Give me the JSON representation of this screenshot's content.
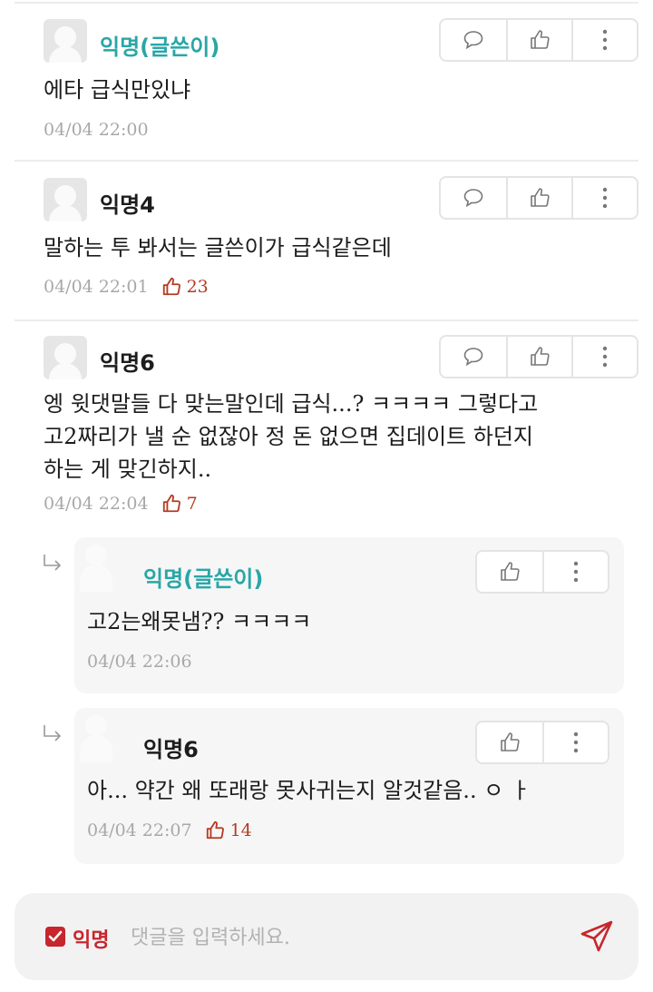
{
  "comments": [
    {
      "author": "익명(글쓴이)",
      "text": [
        "에타 급식만있냐"
      ],
      "time": "04/04 22:00",
      "likes": null
    },
    {
      "author": "익명4",
      "text": [
        "말하는 투 봐서는 글쓴이가 급식같은데"
      ],
      "time": "04/04 22:01",
      "likes": "23"
    },
    {
      "author": "익명6",
      "text": [
        "엥 윗댓말들 다 맞는말인데 급식...? ㅋㅋㅋㅋ 그렇다고",
        "고2짜리가 낼 순 없잖아 정 돈 없으면 집데이트 하던지",
        "하는 게 맞긴하지.."
      ],
      "time": "04/04 22:04",
      "likes": "7"
    }
  ],
  "replies": [
    {
      "author": "익명(글쓴이)",
      "text": "고2는왜못냄?? ㅋㅋㅋㅋ",
      "time": "04/04 22:06",
      "likes": null
    },
    {
      "author": "익명6",
      "text": "아... 약간 왜 또래랑 못사귀는지 알것같음.. ㅇ ㅏ",
      "time": "04/04 22:07",
      "likes": "14"
    }
  ],
  "composer": {
    "anonymous_label": "익명",
    "anonymous_checked": true,
    "placeholder": "댓글을 입력하세요."
  },
  "colors": {
    "writer": "#2aa6a6",
    "accent": "#c7262d",
    "likes": "#b63a22"
  },
  "icons": {
    "comment": "speech-bubble-icon",
    "like": "thumbs-up-icon",
    "more": "vertical-dots-icon",
    "send": "paper-plane-icon",
    "reply": "reply-arrow-icon"
  }
}
